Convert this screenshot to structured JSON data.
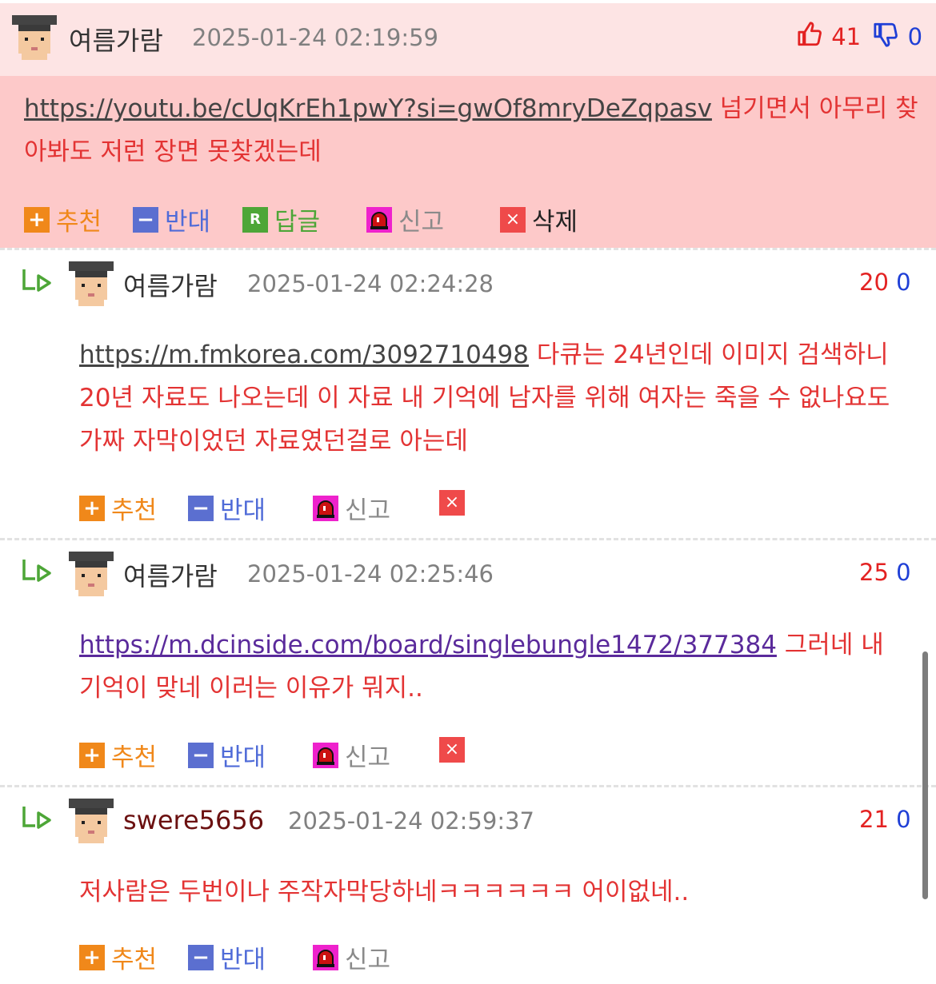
{
  "comments": [
    {
      "author": "여름가람",
      "datetime": "2025-01-24 02:19:59",
      "up": "41",
      "down": "0",
      "link": "https://youtu.be/cUqKrEh1pwY?si=gwOf8mryDeZqpasv",
      "text": " 넘기면서 아무리 찾아봐도 저런 장면 못찾겠는데"
    },
    {
      "author": "여름가람",
      "datetime": "2025-01-24 02:24:28",
      "up": "20",
      "down": "0",
      "link": "https://m.fmkorea.com/3092710498",
      "text": " 다큐는 24년인데 이미지 검색하니 20년 자료도 나오는데 이 자료 내 기억에 남자를 위해 여자는 죽을 수 없나요도 가짜 자막이었던 자료였던걸로 아는데"
    },
    {
      "author": "여름가람",
      "datetime": "2025-01-24 02:25:46",
      "up": "25",
      "down": "0",
      "link": "https://m.dcinside.com/board/singlebungle1472/377384",
      "text": " 그러네 내 기억이 맞네 이러는 이유가 뭐지.."
    },
    {
      "author": "swere5656",
      "datetime": "2025-01-24 02:59:37",
      "up": "21",
      "down": "0",
      "text": "저사람은 두번이나 주작자막당하네ㅋㅋㅋㅋㅋㅋ 어이없네.."
    }
  ],
  "actions": {
    "recommend": "추천",
    "oppose": "반대",
    "reply": "답글",
    "report": "신고",
    "delete": "삭제"
  },
  "icons": {
    "plus_box": "+",
    "minus_box": "−",
    "reply_box": "R",
    "delete_box": "×"
  }
}
